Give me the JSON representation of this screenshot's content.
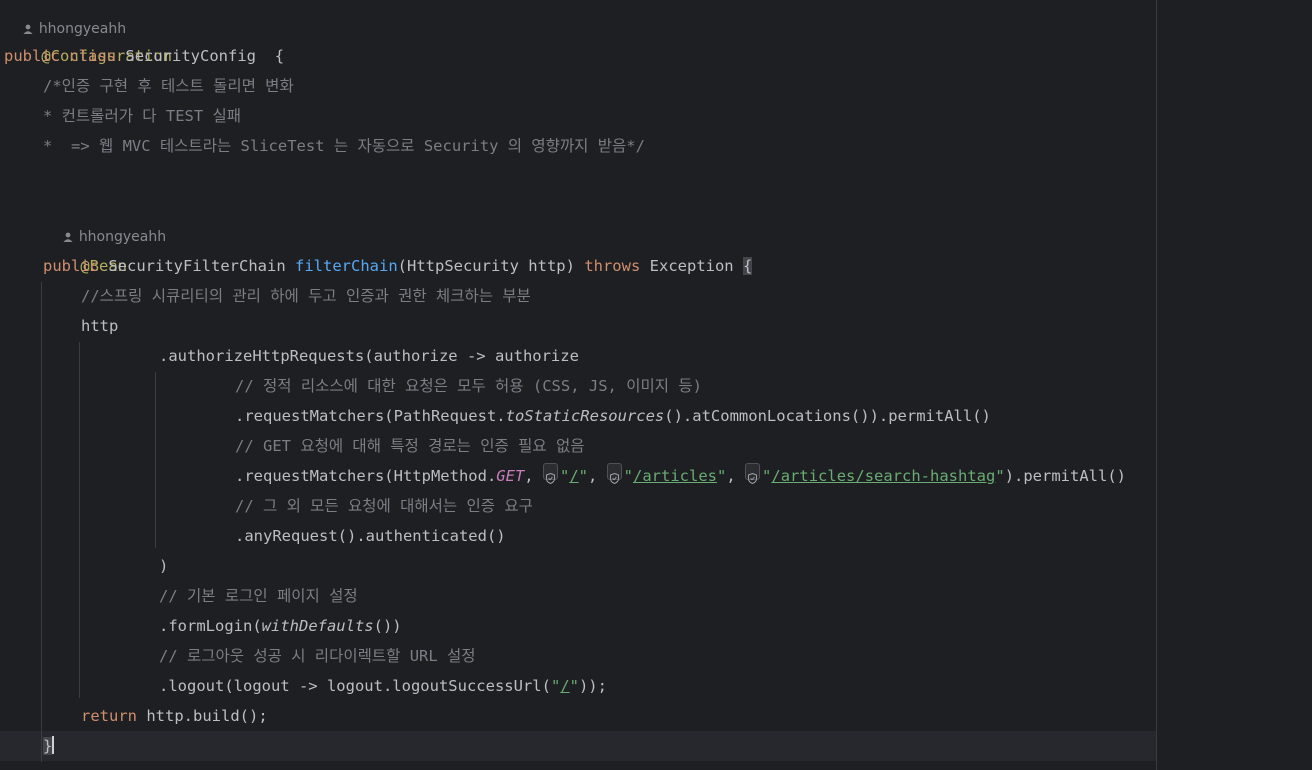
{
  "editor": {
    "top_author": "hhongyeahh",
    "lines": {
      "configuration_annotation": "@Configuration",
      "class_kw_public": "public",
      "class_kw_class": "class",
      "class_name": "SecurityConfig",
      "class_open_brace": "{",
      "doc_comment_1": "/*인증 구현 후 테스트 돌리면 변화",
      "doc_comment_2": "* 컨트롤러가 다 TEST 실패",
      "doc_comment_3": "*  => 웹 MVC 테스트라는 SliceTest 는 자동으로 Security 의 영향까지 받음*/",
      "author_inlay": "hhongyeahh",
      "bean_annotation": "@Bean",
      "method_kw_public": "public",
      "method_return_type": "SecurityFilterChain",
      "method_name": "filterChain",
      "method_params": "(HttpSecurity http)",
      "method_throws": "throws",
      "method_exception": "Exception",
      "method_open_brace": "{",
      "comment_spring_security": "//스프링 시큐리티의 관리 하에 두고 인증과 권한 체크하는 부분",
      "http": "http",
      "authorize_http_requests": ".authorizeHttpRequests(authorize -> authorize",
      "comment_static_resources": "// 정적 리소스에 대한 요청은 모두 허용 (CSS, JS, 이미지 등)",
      "req_matchers_1_prefix": ".requestMatchers(PathRequest.",
      "req_matchers_1_static": "toStaticResources",
      "req_matchers_1_suffix": "().atCommonLocations()).permitAll()",
      "comment_get": "// GET 요청에 대해 특정 경로는 인증 필요 없음",
      "req_matchers_2_prefix": ".requestMatchers(HttpMethod.",
      "req_matchers_2_get": "GET",
      "path_root": "/",
      "path_articles": "/articles",
      "path_search_hashtag": "/articles/search-hashtag",
      "req_matchers_2_suffix": ").permitAll()",
      "comment_other_requests": "// 그 외 모든 요청에 대해서는 인증 요구",
      "any_request": ".anyRequest().authenticated()",
      "close_paren": ")",
      "comment_login_page": "// 기본 로그인 페이지 설정",
      "form_login_prefix": ".formLogin(",
      "form_login_defaults": "withDefaults",
      "form_login_suffix": "())",
      "comment_logout": "// 로그아웃 성공 시 리다이렉트할 URL 설정",
      "logout_prefix": ".logout(logout -> logout.logoutSuccessUrl(",
      "logout_url": "/",
      "logout_suffix": "));",
      "return_kw": "return",
      "return_expr": "http.build();",
      "method_close_brace": "}"
    }
  },
  "colors": {
    "background": "#1e1f22",
    "keyword": "#cf8e6d",
    "annotation": "#b3ae60",
    "function": "#56a8f5",
    "comment": "#7a7e85",
    "string": "#6aab73",
    "constant": "#c77dbb",
    "text": "#bcbec4"
  },
  "icons": [
    "user-icon",
    "shield-icon"
  ]
}
